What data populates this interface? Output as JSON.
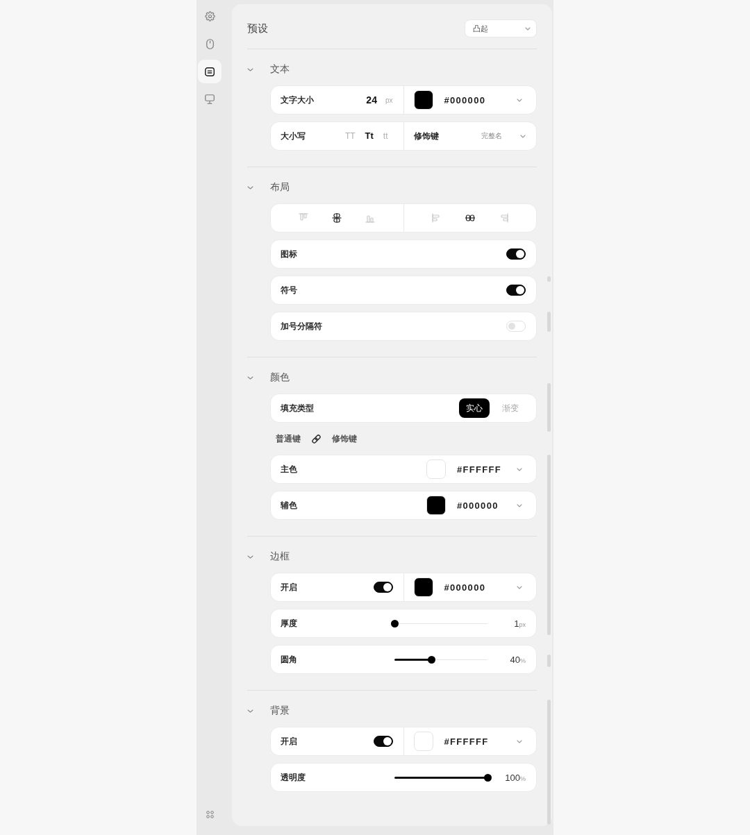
{
  "sidebar": {
    "items": [
      {
        "kind": "settings",
        "selected": false
      },
      {
        "kind": "mouse",
        "selected": false
      },
      {
        "kind": "keycap",
        "selected": true
      },
      {
        "kind": "display",
        "selected": false
      }
    ]
  },
  "preset": {
    "label": "预设",
    "dropdown": {
      "value": "凸起"
    }
  },
  "sections": [
    {
      "title": "文本",
      "expanded": true,
      "rows": [
        {
          "kind": "split",
          "left": {
            "kind": "number",
            "label": "文字大小",
            "value": "24",
            "unit": "px"
          },
          "right": {
            "kind": "color",
            "color": "#000000",
            "value": "#000000"
          }
        },
        {
          "kind": "split",
          "left": {
            "kind": "case",
            "label": "大小写",
            "options": [
              {
                "label": "TT",
                "selected": false
              },
              {
                "label": "Tt",
                "selected": true
              },
              {
                "label": "tt",
                "selected": false
              }
            ]
          },
          "right": {
            "kind": "select",
            "label": "修饰键",
            "value": "完整名"
          }
        }
      ]
    },
    {
      "title": "布局",
      "expanded": true,
      "rows": [
        {
          "kind": "split",
          "left": {
            "kind": "align",
            "options": [
              {
                "kind": "top",
                "selected": false
              },
              {
                "kind": "center",
                "selected": true
              },
              {
                "kind": "bottom",
                "selected": false
              }
            ]
          },
          "right": {
            "kind": "align",
            "options": [
              {
                "kind": "left",
                "selected": false
              },
              {
                "kind": "middle",
                "selected": true
              },
              {
                "kind": "right",
                "selected": false
              }
            ]
          }
        },
        {
          "kind": "toggle",
          "label": "图标",
          "on": true
        },
        {
          "kind": "toggle",
          "label": "符号",
          "on": true
        },
        {
          "kind": "toggle",
          "label": "加号分隔符",
          "on": false
        }
      ]
    },
    {
      "title": "颜色",
      "expanded": true,
      "rows": [
        {
          "kind": "segmented",
          "label": "填充类型",
          "options": [
            {
              "label": "实心",
              "selected": true
            },
            {
              "label": "渐变",
              "selected": false
            }
          ]
        },
        {
          "kind": "link",
          "left": "普通键",
          "right": "修饰键"
        },
        {
          "kind": "color",
          "label": "主色",
          "color": "#ffffff",
          "value": "#FFFFFF"
        },
        {
          "kind": "color",
          "label": "辅色",
          "color": "#000000",
          "value": "#000000"
        }
      ]
    },
    {
      "title": "边框",
      "expanded": true,
      "rows": [
        {
          "kind": "split",
          "left": {
            "kind": "toggle",
            "label": "开启",
            "on": true
          },
          "right": {
            "kind": "color",
            "color": "#000000",
            "value": "#000000"
          }
        },
        {
          "kind": "slider",
          "label": "厚度",
          "level": 0,
          "value": "1",
          "unit": "px"
        },
        {
          "kind": "slider",
          "label": "圆角",
          "level": 0.4,
          "value": "40",
          "unit": "%"
        }
      ]
    },
    {
      "title": "背景",
      "expanded": true,
      "rows": [
        {
          "kind": "split",
          "left": {
            "kind": "toggle",
            "label": "开启",
            "on": true
          },
          "right": {
            "kind": "color",
            "color": "#ffffff",
            "value": "#FFFFFF"
          }
        },
        {
          "kind": "slider",
          "label": "透明度",
          "level": 1,
          "value": "100",
          "unit": "%"
        }
      ]
    }
  ]
}
